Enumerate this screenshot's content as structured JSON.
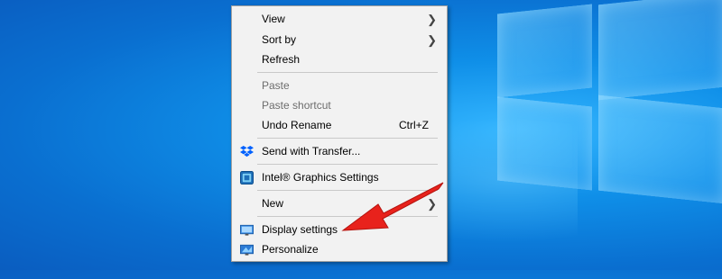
{
  "menu": {
    "items": [
      {
        "label": "View",
        "shortcut": "",
        "submenu": true,
        "disabled": false,
        "icon": ""
      },
      {
        "label": "Sort by",
        "shortcut": "",
        "submenu": true,
        "disabled": false,
        "icon": ""
      },
      {
        "label": "Refresh",
        "shortcut": "",
        "submenu": false,
        "disabled": false,
        "icon": ""
      },
      {
        "label": "Paste",
        "shortcut": "",
        "submenu": false,
        "disabled": true,
        "icon": ""
      },
      {
        "label": "Paste shortcut",
        "shortcut": "",
        "submenu": false,
        "disabled": true,
        "icon": ""
      },
      {
        "label": "Undo Rename",
        "shortcut": "Ctrl+Z",
        "submenu": false,
        "disabled": false,
        "icon": ""
      },
      {
        "label": "Send with Transfer...",
        "shortcut": "",
        "submenu": false,
        "disabled": false,
        "icon": "dropbox-icon"
      },
      {
        "label": "Intel® Graphics Settings",
        "shortcut": "",
        "submenu": false,
        "disabled": false,
        "icon": "intel-graphics-icon"
      },
      {
        "label": "New",
        "shortcut": "",
        "submenu": true,
        "disabled": false,
        "icon": ""
      },
      {
        "label": "Display settings",
        "shortcut": "",
        "submenu": false,
        "disabled": false,
        "icon": "display-settings-icon"
      },
      {
        "label": "Personalize",
        "shortcut": "",
        "submenu": false,
        "disabled": false,
        "icon": "personalize-icon"
      }
    ]
  },
  "colors": {
    "desktop_blue": "#0a6fd0",
    "menu_bg": "#f2f2f2",
    "disabled_text": "#6d6d6d",
    "arrow_red": "#e8221c",
    "dropbox_blue": "#0061fe"
  }
}
